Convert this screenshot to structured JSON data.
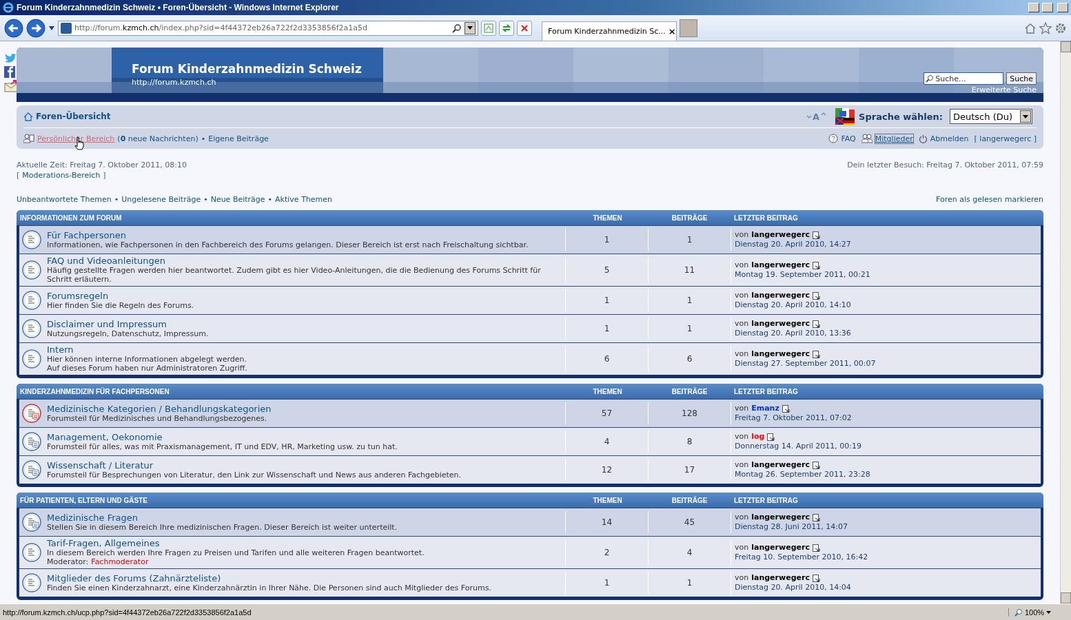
{
  "window": {
    "title": "Forum Kinderzahnmedizin Schweiz • Foren-Übersicht - Windows Internet Explorer"
  },
  "browser": {
    "address": "http://forum.**kzmch.ch**/index.php?sid=4f44372eb26a722f2d3353856f2a1a5d",
    "tab": "Forum Kinderzahnmedizin Sc...",
    "tab_close": "×"
  },
  "banner": {
    "title": "Forum Kinderzahnmedizin Schweiz",
    "subtitle": "http://forum.kzmch.ch",
    "search_placeholder": "Suche...",
    "search_button": "Suche",
    "advanced_search": "Erweiterte Suche"
  },
  "navbar": {
    "home": "Foren-Übersicht",
    "font_size": "A",
    "language_label": "Sprache wählen:",
    "language": "Deutsch (Du)",
    "personal": {
      "label": "Persönlicher Bereich",
      "hovered": true
    },
    "messages": "(**0** neue Nachrichten)",
    "separator": "•",
    "own_posts": "Eigene Beiträge",
    "right_links": [
      {
        "kind": "faq",
        "label": "FAQ",
        "focused": false
      },
      {
        "kind": "members",
        "label": "Mitglieder",
        "focused": true
      },
      {
        "kind": "logout",
        "label": "Abmelden",
        "focused": false
      }
    ],
    "user": "[ langerwegerc ]"
  },
  "info": {
    "current_time": "Aktuelle Zeit: Freitag 7. Oktober 2011, 08:10",
    "moderation": "Moderations-Bereich",
    "bracket_open": "[",
    "bracket_close": "]",
    "last_visit": "Dein letzter Besuch: Freitag 7. Oktober 2011, 07:59"
  },
  "quick_links": [
    {
      "label": "Unbeantwortete Themen"
    },
    {
      "label": "Ungelesene Beiträge"
    },
    {
      "label": "Neue Beiträge"
    },
    {
      "label": "Aktive Themen"
    }
  ],
  "quick_separator": "•",
  "mark_read": "Foren als gelesen markieren",
  "sections": [
    {
      "title": "INFORMATIONEN ZUM FORUM",
      "columns": [
        "THEMEN",
        "BEITRÄGE",
        "LETZTER BEITRAG"
      ],
      "forums": [
        {
          "highlighted": true,
          "kind": "forum",
          "title": "Für Fachpersonen",
          "description": [
            "Informationen, wie Fachpersonen in den Fachbereich des Forums gelangen. Dieser Bereich ist erst nach Freischaltung sichtbar."
          ],
          "topics": "1",
          "posts": "1",
          "last": {
            "by": "von",
            "author": "langerwegerc",
            "color": "#000000",
            "date": "Dienstag 20. April 2010, 14:27"
          }
        },
        {
          "highlighted": false,
          "kind": "forum",
          "title": "FAQ und Videoanleitungen",
          "description": [
            "Häufig gestellte Fragen werden hier beantwortet. Zudem gibt es hier Video-Anleitungen, die die Bedienung des Forums Schritt für",
            "Schritt erläutern."
          ],
          "topics": "5",
          "posts": "11",
          "last": {
            "by": "von",
            "author": "langerwegerc",
            "color": "#000000",
            "date": "Montag 19. September 2011, 00:21"
          }
        },
        {
          "highlighted": false,
          "kind": "forum",
          "title": "Forumsregeln",
          "description": [
            "Hier finden Sie die Regeln des Forums."
          ],
          "topics": "1",
          "posts": "1",
          "last": {
            "by": "von",
            "author": "langerwegerc",
            "color": "#000000",
            "date": "Dienstag 20. April 2010, 14:10"
          }
        },
        {
          "highlighted": false,
          "kind": "forum",
          "title": "Disclaimer und Impressum",
          "description": [
            "Nutzungsregeln, Datenschutz, Impressum."
          ],
          "topics": "1",
          "posts": "1",
          "last": {
            "by": "von",
            "author": "langerwegerc",
            "color": "#000000",
            "date": "Dienstag 20. April 2010, 13:36"
          }
        },
        {
          "highlighted": false,
          "kind": "forum",
          "title": "Intern",
          "description": [
            "Hier können interne Informationen abgelegt werden.",
            "Auf dieses Forum haben nur Administratoren Zugriff."
          ],
          "topics": "6",
          "posts": "6",
          "last": {
            "by": "von",
            "author": "langerwegerc",
            "color": "#000000",
            "date": "Dienstag 27. September 2011, 00:07"
          }
        }
      ]
    },
    {
      "title": "KINDERZAHNMEDIZIN FÜR FACHPERSONEN",
      "columns": [
        "THEMEN",
        "BEITRÄGE",
        "LETZTER BEITRAG"
      ],
      "forums": [
        {
          "highlighted": true,
          "kind": "unread_parent",
          "title": "Medizinische Kategorien / Behandlungskategorien",
          "description": [
            "Forumsteil für Medizinisches und Behandlungsbezogenes."
          ],
          "topics": "57",
          "posts": "128",
          "last": {
            "by": "von",
            "author": "Emanz",
            "color": "#0033cc",
            "date": "Freitag 7. Oktober 2011, 07:02"
          }
        },
        {
          "highlighted": false,
          "kind": "parent",
          "title": "Management, Oekonomie",
          "description": [
            "Forumsteil für alles, was mit Praxismanagement, IT und EDV, HR, Marketing usw. zu tun hat."
          ],
          "topics": "4",
          "posts": "8",
          "last": {
            "by": "von",
            "author": "log",
            "color": "#ff0000",
            "date": "Donnerstag 14. April 2011, 00:19"
          }
        },
        {
          "highlighted": false,
          "kind": "parent",
          "title": "Wissenschaft / Literatur",
          "description": [
            "Forumsteil für Besprechungen von Literatur, den Link zur Wissenschaft und News aus anderen Fachgebieten."
          ],
          "topics": "12",
          "posts": "17",
          "last": {
            "by": "von",
            "author": "langerwegerc",
            "color": "#000000",
            "date": "Montag 26. September 2011, 23:28"
          }
        }
      ]
    },
    {
      "title": "FÜR PATIENTEN, ELTERN UND GÄSTE",
      "columns": [
        "THEMEN",
        "BEITRÄGE",
        "LETZTER BEITRAG"
      ],
      "forums": [
        {
          "highlighted": true,
          "kind": "parent",
          "title": "Medizinische Fragen",
          "description": [
            "Stellen Sie in diesem Bereich Ihre medizinischen Fragen. Dieser Bereich ist weiter unterteilt."
          ],
          "topics": "14",
          "posts": "45",
          "last": {
            "by": "von",
            "author": "langerwegerc",
            "color": "#000000",
            "date": "Dienstag 28. Juni 2011, 14:07"
          }
        },
        {
          "highlighted": false,
          "kind": "forum",
          "title": "Tarif-Fragen, Allgemeines",
          "description": [
            "In diesem Bereich werden Ihre Fragen zu Preisen und Tarifen und alle weiteren Fragen beantwortet."
          ],
          "moderator": {
            "label": "Moderator:",
            "name": "Fachmoderator"
          },
          "topics": "2",
          "posts": "4",
          "last": {
            "by": "von",
            "author": "langerwegerc",
            "color": "#000000",
            "date": "Freitag 10. September 2010, 16:42"
          }
        },
        {
          "highlighted": false,
          "kind": "forum",
          "title": "Mitglieder des Forums (Zahnärzteliste)",
          "description": [
            "Finden Sie einen Kinderzahnarzt, eine Kinderzahnärztin in Ihrer Nähe. Die Personen sind auch Mitglieder des Forums."
          ],
          "topics": "1",
          "posts": "1",
          "last": {
            "by": "von",
            "author": "langerwegerc",
            "color": "#000000",
            "date": "Dienstag 20. April 2010, 14:04"
          }
        }
      ]
    }
  ],
  "status_bar": {
    "url": "http://forum.kzmch.ch/ucp.php?sid=4f44372eb26a722f2d3353856f2a1a5d",
    "zoom": "100%"
  }
}
